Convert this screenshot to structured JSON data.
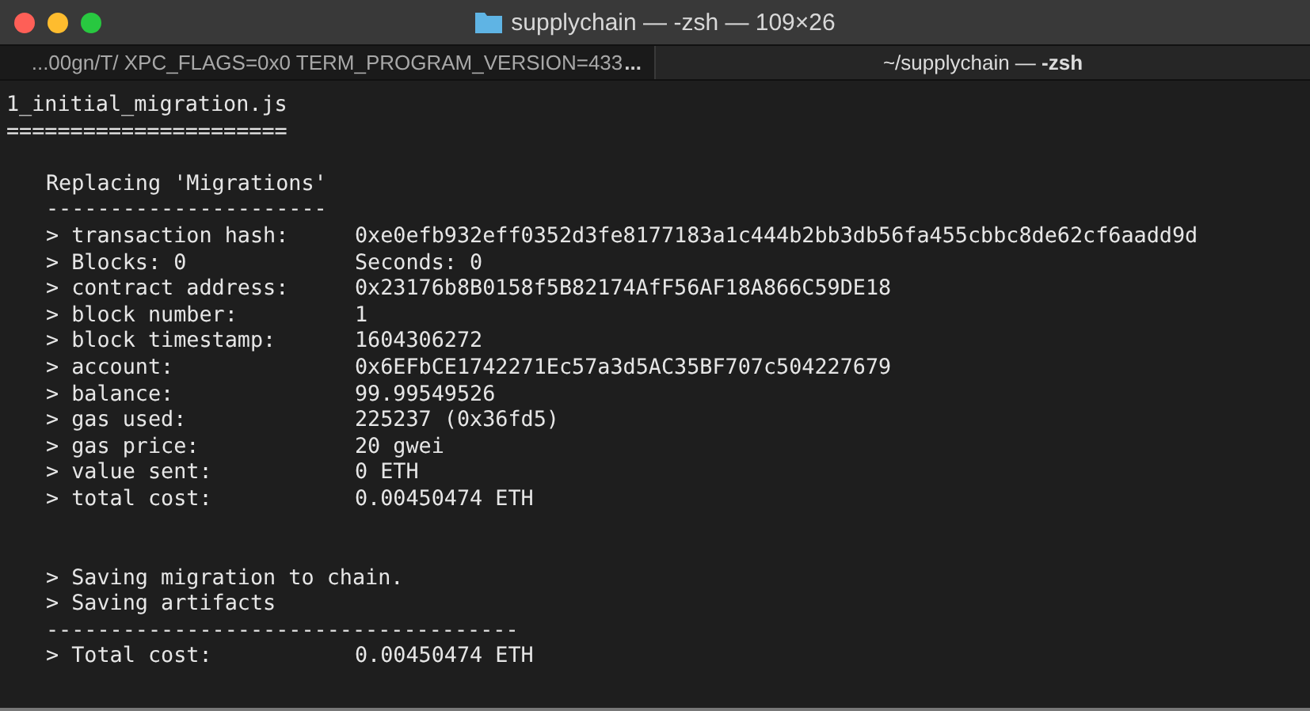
{
  "window": {
    "title": "supplychain — -zsh — 109×26"
  },
  "tabs": [
    {
      "label": "...00gn/T/ XPC_FLAGS=0x0 TERM_PROGRAM_VERSION=433",
      "overflow": "...",
      "selected": false
    },
    {
      "label": "~/supplychain — ",
      "bold_label": "-zsh",
      "selected": true
    }
  ],
  "terminal": {
    "heading": "1_initial_migration.js",
    "heading_rule": "======================",
    "section": "Replacing 'Migrations'",
    "section_rule": "----------------------",
    "rows": [
      {
        "label": "> transaction hash:",
        "value": "0xe0efb932eff0352d3fe8177183a1c444b2bb3db56fa455cbbc8de62cf6aadd9d"
      },
      {
        "label": "> Blocks: 0",
        "value": "Seconds: 0"
      },
      {
        "label": "> contract address:",
        "value": "0x23176b8B0158f5B82174AfF56AF18A866C59DE18"
      },
      {
        "label": "> block number:",
        "value": "1"
      },
      {
        "label": "> block timestamp:",
        "value": "1604306272"
      },
      {
        "label": "> account:",
        "value": "0x6EFbCE1742271Ec57a3d5AC35BF707c504227679"
      },
      {
        "label": "> balance:",
        "value": "99.99549526"
      },
      {
        "label": "> gas used:",
        "value": "225237 (0x36fd5)"
      },
      {
        "label": "> gas price:",
        "value": "20 gwei"
      },
      {
        "label": "> value sent:",
        "value": "0 ETH"
      },
      {
        "label": "> total cost:",
        "value": "0.00450474 ETH"
      }
    ],
    "messages": [
      "> Saving migration to chain.",
      "> Saving artifacts"
    ],
    "total_rule": "-------------------------------------",
    "total": {
      "label": "> Total cost:",
      "value": "0.00450474 ETH"
    }
  }
}
